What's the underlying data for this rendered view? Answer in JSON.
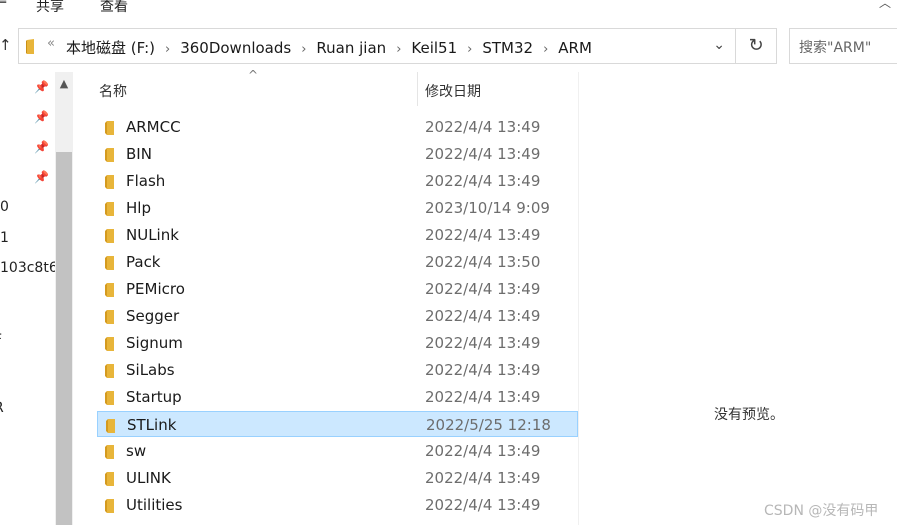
{
  "ribbon": {
    "left_fragment": "≡",
    "tabs": [
      "共享",
      "查看"
    ],
    "window_control": "︿"
  },
  "nav_back_symbol": "↑",
  "address": {
    "overflow": "«",
    "crumbs": [
      "本地磁盘 (F:)",
      "360Downloads",
      "Ruan jian",
      "Keil51",
      "STM32",
      "ARM"
    ],
    "separator": "›",
    "dropdown": "⌄",
    "refresh": "↻"
  },
  "search": {
    "placeholder": "搜索\"ARM\""
  },
  "nav_pane": {
    "pin_symbol": "📌",
    "fragments": [
      "0",
      "1",
      "103c8t6",
      "F",
      "R"
    ]
  },
  "columns": {
    "name": "名称",
    "date": "修改日期",
    "sort_indicator": "^"
  },
  "files": [
    {
      "name": "ARMCC",
      "date": "2022/4/4 13:49",
      "selected": false
    },
    {
      "name": "BIN",
      "date": "2022/4/4 13:49",
      "selected": false
    },
    {
      "name": "Flash",
      "date": "2022/4/4 13:49",
      "selected": false
    },
    {
      "name": "Hlp",
      "date": "2023/10/14 9:09",
      "selected": false
    },
    {
      "name": "NULink",
      "date": "2022/4/4 13:49",
      "selected": false
    },
    {
      "name": "Pack",
      "date": "2022/4/4 13:50",
      "selected": false
    },
    {
      "name": "PEMicro",
      "date": "2022/4/4 13:49",
      "selected": false
    },
    {
      "name": "Segger",
      "date": "2022/4/4 13:49",
      "selected": false
    },
    {
      "name": "Signum",
      "date": "2022/4/4 13:49",
      "selected": false
    },
    {
      "name": "SiLabs",
      "date": "2022/4/4 13:49",
      "selected": false
    },
    {
      "name": "Startup",
      "date": "2022/4/4 13:49",
      "selected": false
    },
    {
      "name": "STLink",
      "date": "2022/5/25 12:18",
      "selected": true
    },
    {
      "name": "sw",
      "date": "2022/4/4 13:49",
      "selected": false
    },
    {
      "name": "ULINK",
      "date": "2022/4/4 13:49",
      "selected": false
    },
    {
      "name": "Utilities",
      "date": "2022/4/4 13:49",
      "selected": false
    }
  ],
  "preview": {
    "empty_text": "没有预览。"
  },
  "watermark": "CSDN @没有码甲",
  "colors": {
    "folder": "#e8b53a",
    "folder_dark": "#d49a1f",
    "selection": "#cce8ff",
    "selection_border": "#99d1ff"
  }
}
